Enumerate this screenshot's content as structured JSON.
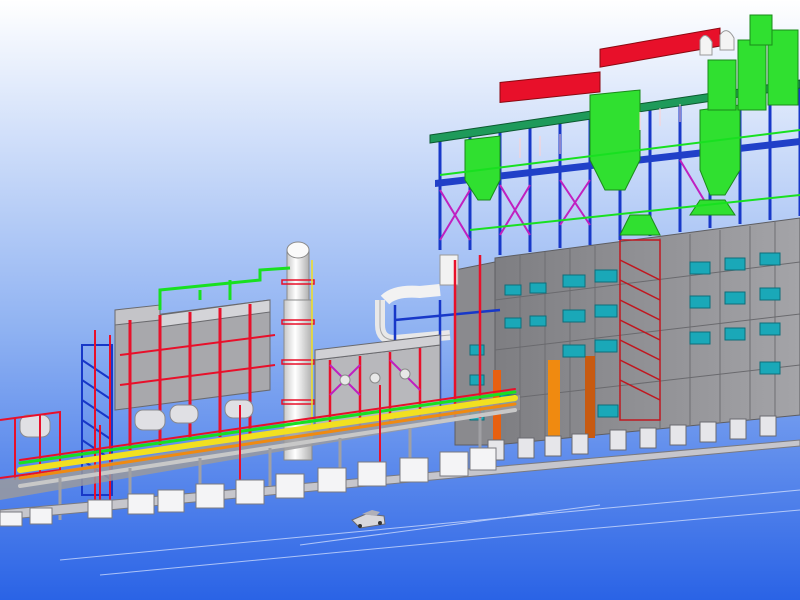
{
  "viewport": {
    "background_top": "#ffffff",
    "background_bottom": "#2a63e6"
  },
  "palette": {
    "steel_red": "#e8102a",
    "steel_blue": "#1838c8",
    "pipe_green": "#18e020",
    "pipe_yellow": "#f2e020",
    "pipe_orange": "#f08a10",
    "magenta": "#c020c0",
    "cladding_gray": "#8c8c90",
    "window_teal": "#1aa8b8",
    "column_white": "#f2f2f2",
    "foundation_white": "#f4f4f4"
  },
  "model_parts": [
    "boiler-building",
    "boiler-roof-equipment",
    "distillation-column",
    "process-unit-left",
    "process-unit-middle",
    "pipe-rack",
    "foundation-piers",
    "vehicle"
  ]
}
